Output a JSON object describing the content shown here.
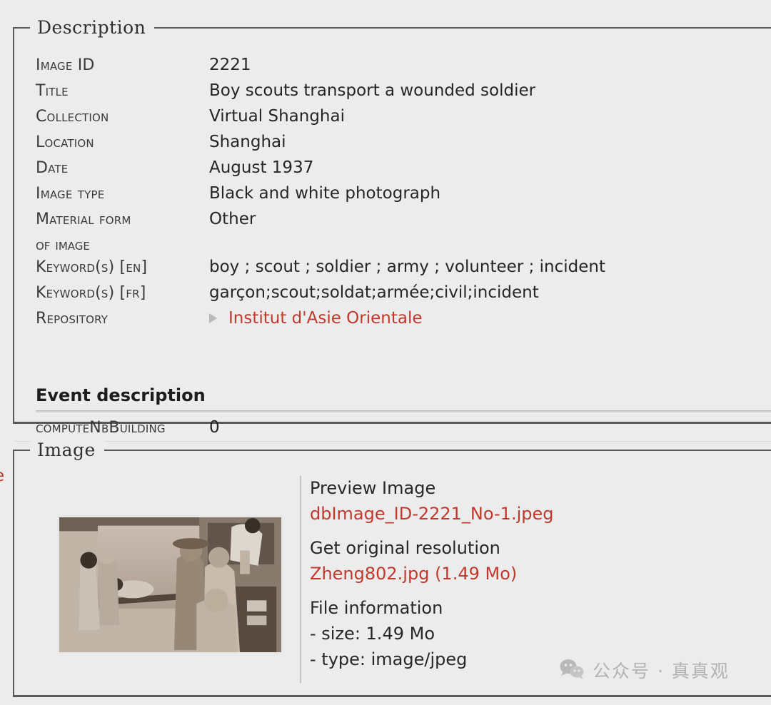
{
  "description": {
    "legend": "Description",
    "fields": [
      {
        "label": "Image ID",
        "value": "2221"
      },
      {
        "label": "Title",
        "value": "Boy scouts transport a wounded soldier"
      },
      {
        "label": "Collection",
        "value": "Virtual Shanghai"
      },
      {
        "label": "Location",
        "value": "Shanghai"
      },
      {
        "label": "Date",
        "value": "August 1937"
      },
      {
        "label": "Image type",
        "value": "Black and white photograph"
      },
      {
        "label": "Material form",
        "value": "Other",
        "label_cont": "of image"
      },
      {
        "label": "Keyword(s) [en]",
        "value": "boy ; scout ; soldier ; army ; volunteer ; incident"
      },
      {
        "label": "Keyword(s) [fr]",
        "value": "garçon;scout;soldat;armée;civil;incident"
      },
      {
        "label": "Repository",
        "value": "Institut d'Asie Orientale",
        "is_link": true
      }
    ],
    "event_heading": "Event description",
    "event_field": {
      "label": "computeNbBuilding",
      "value": "0"
    }
  },
  "image_section": {
    "legend": "Image",
    "preview_heading": "Preview Image",
    "preview_filename": "dbImage_ID-2221_No-1.jpeg",
    "original_heading": "Get original resolution",
    "original_filename": "Zheng802.jpg (1.49 Mo)",
    "file_info_heading": "File information",
    "file_size": "- size: 1.49 Mo",
    "file_type": "- type: image/jpeg",
    "photo_alt": "Black and white photograph of boy scouts carrying a wounded soldier on a stretcher"
  },
  "clipped_fragment": "e",
  "watermark": {
    "icon": "wechat-icon",
    "text": "公众号 · 真真观"
  },
  "colors": {
    "link": "#c0392b",
    "background": "#ececec",
    "border": "#595959",
    "watermark": "#b0b0b0"
  }
}
